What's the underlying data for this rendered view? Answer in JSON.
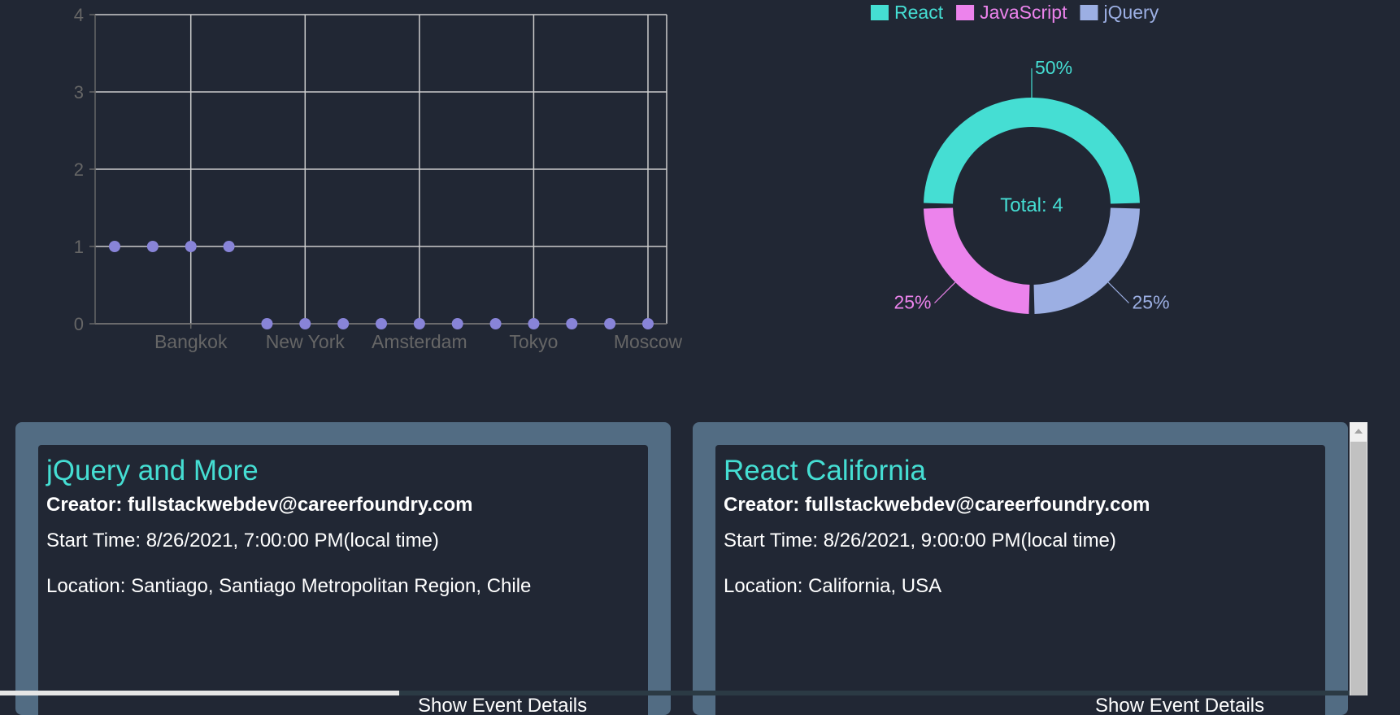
{
  "scatter_chart": {
    "type": "scatter",
    "x_ticks": [
      "Bangkok",
      "New York",
      "Amsterdam",
      "Tokyo",
      "Moscow"
    ],
    "y_ticks": [
      "0",
      "1",
      "2",
      "3",
      "4"
    ],
    "ylim": [
      0,
      4
    ],
    "points": [
      1,
      1,
      1,
      1,
      0,
      0,
      0,
      0,
      0,
      0,
      0,
      0,
      0,
      0,
      0
    ],
    "point_color": "#8884d8",
    "grid": true
  },
  "donut_chart": {
    "type": "pie",
    "legend": [
      "React",
      "JavaScript",
      "jQuery"
    ],
    "slices": [
      {
        "name": "React",
        "value": 2,
        "label": "50%",
        "color": "#45ded3"
      },
      {
        "name": "JavaScript",
        "value": 1,
        "label": "25%",
        "color": "#ec83ec"
      },
      {
        "name": "jQuery",
        "value": 1,
        "label": "25%",
        "color": "#9cafe3"
      }
    ],
    "center_text": "Total: 4",
    "legend_position": "top"
  },
  "events": [
    {
      "title": "jQuery and More",
      "creator": "Creator: fullstackwebdev@careerfoundry.com",
      "start": "Start Time: 8/26/2021, 7:00:00 PM(local time)",
      "location": "Location: Santiago, Santiago Metropolitan Region, Chile",
      "details_label": "Show Event Details"
    },
    {
      "title": "React California",
      "creator": "Creator: fullstackwebdev@careerfoundry.com",
      "start": "Start Time: 8/26/2021, 9:00:00 PM(local time)",
      "location": "Location: California, USA",
      "details_label": "Show Event Details"
    }
  ],
  "scrollbar": {
    "up_icon": "triangle-up-icon"
  }
}
